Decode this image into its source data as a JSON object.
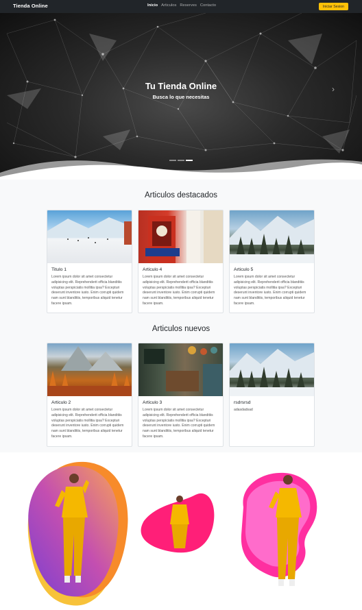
{
  "navbar": {
    "brand": "Tienda Online",
    "links": [
      "Inicio",
      "Articulos",
      "Reserves",
      "Contacto"
    ],
    "login": "Iniciar Sesion"
  },
  "hero": {
    "title": "Tu Tienda Online",
    "subtitle": "Busca lo que necesitas",
    "next_icon": "chevron-right-icon",
    "slides": 3,
    "active_slide": 3
  },
  "featured": {
    "title": "Articulos destacados",
    "cards": [
      {
        "title": "Titulo 1",
        "text": "Lorem ipsum dolor sit amet consectetur adipisicing elit. Reprehenderit officia blanditiis voluptas perspiciatis mollitia ipsa? Excepturi deserunt inventore iusto. Enim corrupti quidem nam sunt blanditiis, temporibus aliquid tenetur facere ipsam."
      },
      {
        "title": "Articulo 4",
        "text": "Lorem ipsum dolor sit amet consectetur adipisicing elit. Reprehenderit officia blanditiis voluptas perspiciatis mollitia ipsa? Excepturi deserunt inventore iusto. Enim corrupti quidem nam sunt blanditiis, temporibus aliquid tenetur facere ipsam."
      },
      {
        "title": "Articulo 5",
        "text": "Lorem ipsum dolor sit amet consectetur adipisicing elit. Reprehenderit officia blanditiis voluptas perspiciatis mollitia ipsa? Excepturi deserunt inventore iusto. Enim corrupti quidem nam sunt blanditiis, temporibus aliquid tenetur facere ipsam."
      }
    ]
  },
  "new": {
    "title": "Articulos nuevos",
    "cards": [
      {
        "title": "Articulo 2",
        "text": "Lorem ipsum dolor sit amet consectetur adipisicing elit. Reprehenderit officia blanditiis voluptas perspiciatis mollitia ipsa? Excepturi deserunt inventore iusto. Enim corrupti quidem nam sunt blanditiis, temporibus aliquid tenetur facere ipsam."
      },
      {
        "title": "Articulo 3",
        "text": "Lorem ipsum dolor sit amet consectetur adipisicing elit. Reprehenderit officia blanditiis voluptas perspiciatis mollitia ipsa? Excepturi deserunt inventore iusto. Enim corrupti quidem nam sunt blanditiis, temporibus aliquid tenetur facere ipsam."
      },
      {
        "title": "rsdrsrsd",
        "text": "adasdadsad"
      }
    ]
  },
  "colors": {
    "navbar_bg": "#212529",
    "accent": "#ffc107",
    "section_bg": "#f8f9fa",
    "blob_orange": "#f7931e",
    "blob_purple": "#8e44ad",
    "blob_pink": "#ff1f8e",
    "figure_yellow": "#f5b800"
  }
}
